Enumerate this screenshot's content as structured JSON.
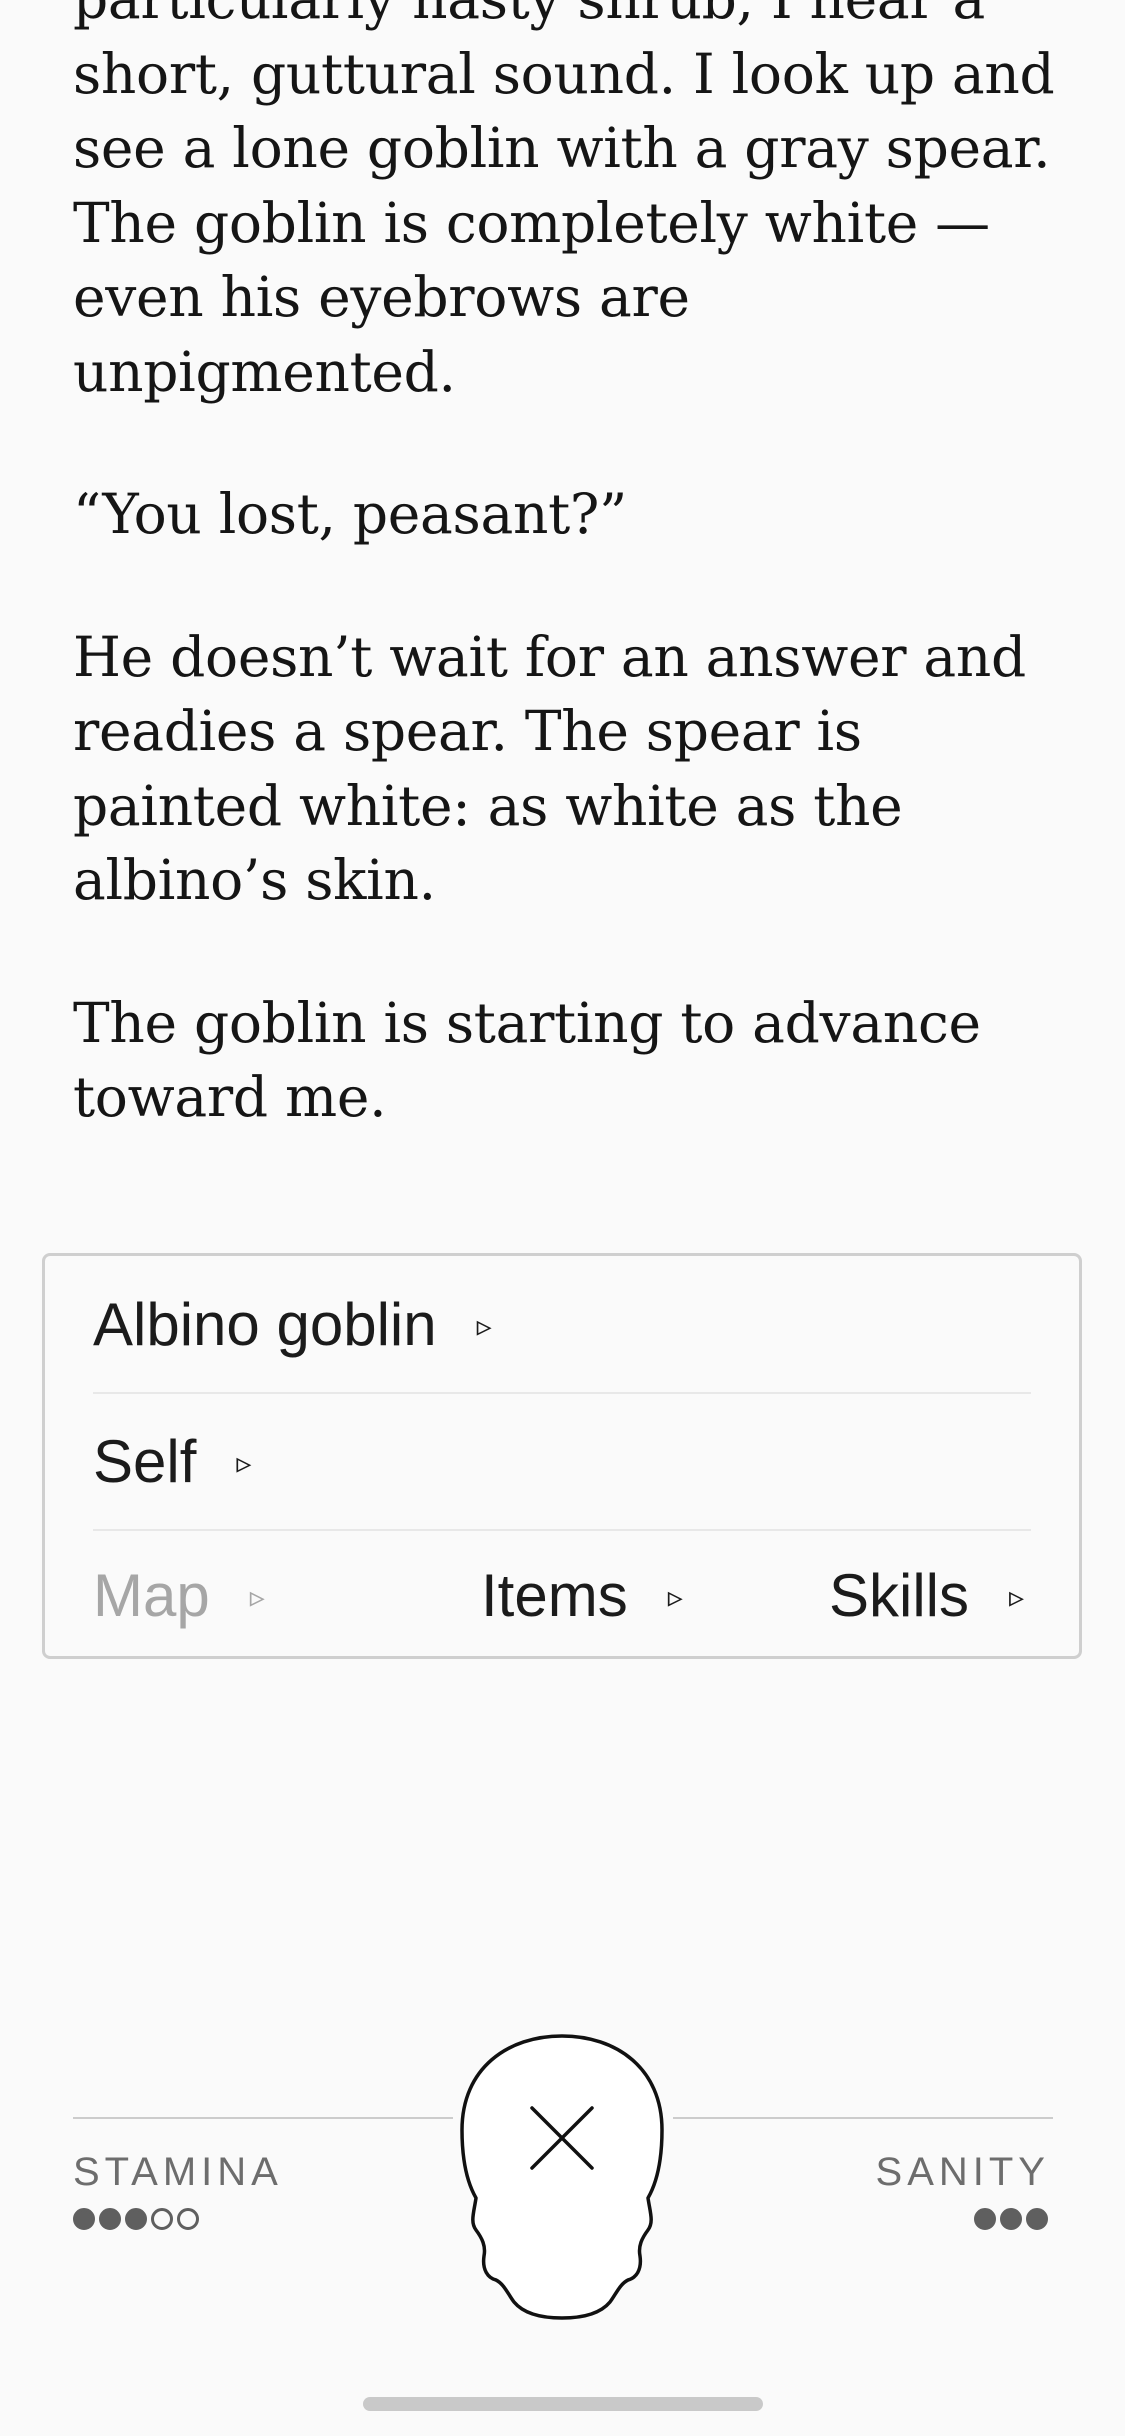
{
  "story": {
    "paragraphs": [
      {
        "lines": [
          "particularly nasty shrub, I hear a",
          "short, guttural sound. I look up and",
          "see a lone goblin with a gray spear.",
          "The goblin is completely white —",
          "even his eyebrows are",
          "unpigmented."
        ]
      },
      {
        "lines": [
          "“You lost, peasant?”"
        ]
      },
      {
        "lines": [
          "He doesn’t wait for an answer and",
          "readies a spear. The spear is",
          "painted white: as white as the",
          "albino’s skin."
        ]
      },
      {
        "lines": [
          "The goblin is starting to advance",
          "toward me."
        ]
      }
    ]
  },
  "actions": {
    "target": "Albino goblin",
    "self": "Self",
    "map": "Map",
    "items": "Items",
    "skills": "Skills",
    "arrow": "▹"
  },
  "status": {
    "stamina_label": "STAMINA",
    "stamina": {
      "current": 3,
      "max": 5
    },
    "sanity_label": "SANITY",
    "sanity": {
      "current": 3,
      "max": 3
    },
    "center_icon": "skull-close-icon"
  },
  "colors": {
    "background": "#fafafa",
    "text": "#151515",
    "disabled": "#a6a6a6",
    "pip": "#5f5f5f"
  }
}
